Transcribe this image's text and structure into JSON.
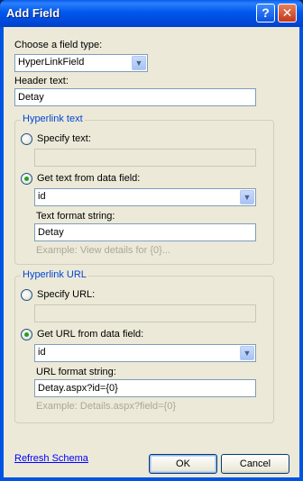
{
  "window": {
    "title": "Add Field",
    "help_glyph": "?",
    "close_glyph": "✕"
  },
  "field_type": {
    "label": "Choose a field type:",
    "value": "HyperLinkField"
  },
  "header_text": {
    "label": "Header text:",
    "value": "Detay"
  },
  "hyperlink_text": {
    "legend": "Hyperlink text",
    "specify_label": "Specify text:",
    "specify_value": "",
    "get_from_label": "Get text from data field:",
    "data_field": "id",
    "format_label": "Text format string:",
    "format_value": "Detay",
    "example": "Example: View details for {0}..."
  },
  "hyperlink_url": {
    "legend": "Hyperlink URL",
    "specify_label": "Specify URL:",
    "specify_value": "",
    "get_from_label": "Get URL from data field:",
    "data_field": "id",
    "format_label": "URL format string:",
    "format_value": "Detay.aspx?id={0}",
    "example": "Example: Details.aspx?field={0}"
  },
  "footer": {
    "refresh_link": "Refresh Schema",
    "ok": "OK",
    "cancel": "Cancel"
  },
  "icons": {
    "dropdown_arrow": "chevron-down-icon"
  }
}
